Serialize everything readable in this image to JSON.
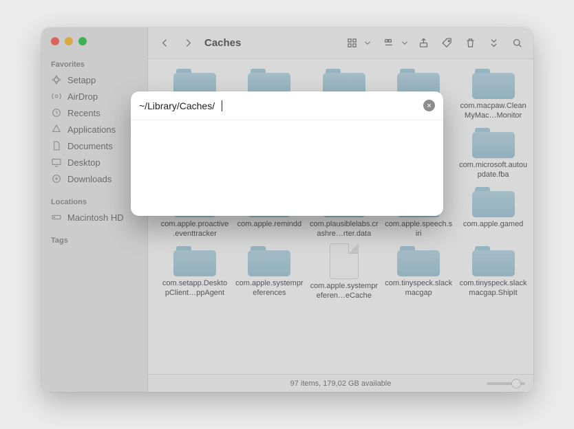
{
  "window": {
    "title": "Caches"
  },
  "sidebar": {
    "sections": [
      {
        "label": "Favorites",
        "items": [
          {
            "icon": "setapp-icon",
            "label": "Setapp"
          },
          {
            "icon": "airdrop-icon",
            "label": "AirDrop"
          },
          {
            "icon": "recents-icon",
            "label": "Recents"
          },
          {
            "icon": "apps-icon",
            "label": "Applications"
          },
          {
            "icon": "doc-icon",
            "label": "Documents"
          },
          {
            "icon": "desktop-icon",
            "label": "Desktop"
          },
          {
            "icon": "downloads-icon",
            "label": "Downloads"
          }
        ]
      },
      {
        "label": "Locations",
        "items": [
          {
            "icon": "disk-icon",
            "label": "Macintosh HD"
          }
        ]
      },
      {
        "label": "Tags",
        "items": []
      }
    ]
  },
  "folders": {
    "row1": [
      {
        "kind": "folder",
        "name": ""
      },
      {
        "kind": "folder",
        "name": ""
      },
      {
        "kind": "folder",
        "name": ""
      },
      {
        "kind": "folder",
        "name": ""
      },
      {
        "kind": "folder",
        "name": "com.macpaw.CleanMyMac…Monitor"
      }
    ],
    "row2": [
      {
        "kind": "folder",
        "name": ""
      },
      {
        "kind": "folder",
        "name": ""
      },
      {
        "kind": "folder",
        "name": ""
      },
      {
        "kind": "folder",
        "name": ""
      },
      {
        "kind": "folder",
        "name": "com.microsoft.autoupdate.fba"
      }
    ],
    "row3": [
      {
        "kind": "folder",
        "name": "com.apple.proactive.eventtracker"
      },
      {
        "kind": "folder",
        "name": "com.apple.remindd"
      },
      {
        "kind": "folder",
        "name": "com.plausiblelabs.crashre…rter.data"
      },
      {
        "kind": "folder",
        "name": "com.apple.speech.siri"
      },
      {
        "kind": "folder",
        "name": "com.apple.gamed"
      }
    ],
    "row4": [
      {
        "kind": "folder",
        "name": "com.setapp.DesktopClient…ppAgent"
      },
      {
        "kind": "folder",
        "name": "com.apple.systempreferences"
      },
      {
        "kind": "file",
        "name": "com.apple.systempreferen…eCache"
      },
      {
        "kind": "folder",
        "name": "com.tinyspeck.slackmacgap"
      },
      {
        "kind": "folder",
        "name": "com.tinyspeck.slackmacgap.ShipIt"
      }
    ]
  },
  "status": {
    "text": "97 items, 179,02 GB available"
  },
  "dialog": {
    "path": "~/Library/Caches/"
  }
}
